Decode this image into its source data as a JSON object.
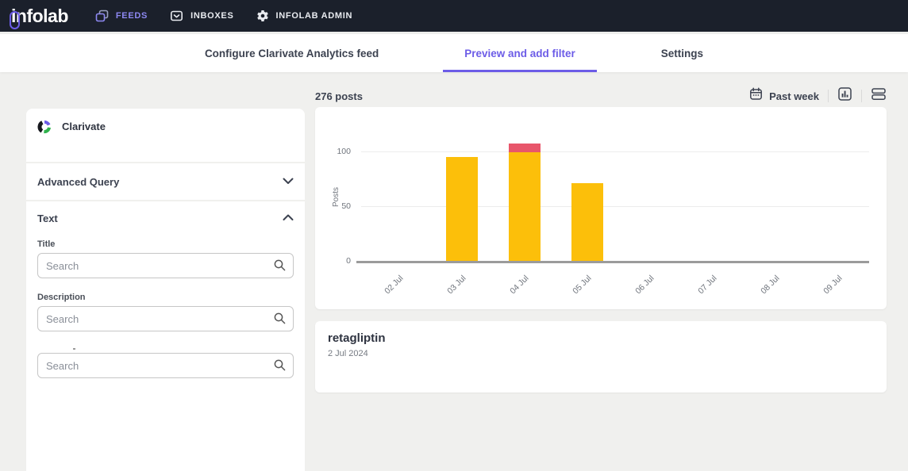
{
  "topbar": {
    "logo": "infolab",
    "nav": [
      {
        "label": "FEEDS",
        "icon": "feeds-icon",
        "active": true
      },
      {
        "label": "INBOXES",
        "icon": "inboxes-icon",
        "active": false
      },
      {
        "label": "INFOLAB ADMIN",
        "icon": "gear-icon",
        "active": false
      }
    ]
  },
  "tabs": [
    {
      "label": "Configure Clarivate Analytics feed",
      "active": false
    },
    {
      "label": "Preview and add filter",
      "active": true
    },
    {
      "label": "Settings",
      "active": false
    }
  ],
  "sidebar": {
    "source": {
      "name": "Clarivate",
      "icon": "clarivate-logo"
    },
    "advanced_query": {
      "label": "Advanced Query",
      "state": "collapsed",
      "icon": "chevron-down-icon"
    },
    "text_section": {
      "label": "Text",
      "state": "expanded",
      "icon": "chevron-up-icon"
    },
    "fields": [
      {
        "label": "Title",
        "placeholder": "Search",
        "value": ""
      },
      {
        "label": "Description",
        "placeholder": "Search",
        "value": ""
      },
      {
        "label": "",
        "placeholder": "Search",
        "value": ""
      }
    ]
  },
  "main": {
    "post_count": "276 posts",
    "range_label": "Past week",
    "range_icon": "calendar-icon",
    "view_toggles": [
      "chart-view-icon",
      "list-view-icon"
    ],
    "post": {
      "title": "retagliptin",
      "date": "2 Jul 2024"
    }
  },
  "colors": {
    "accent_purple": "#6c5ce7",
    "nav_purple": "#8d88f2",
    "bar_yellow": "#fcbf0a",
    "bar_red": "#e8566b",
    "topbar_bg": "#1b202b",
    "page_bg": "#f0f0ee"
  },
  "chart_data": {
    "type": "bar",
    "stacked": true,
    "categories": [
      "02 Jul",
      "03 Jul",
      "04 Jul",
      "05 Jul",
      "06 Jul",
      "07 Jul",
      "08 Jul",
      "09 Jul"
    ],
    "series": [
      {
        "name": "posts-primary",
        "color": "#fcbf0a",
        "values": [
          0,
          96,
          100,
          72,
          0,
          0,
          0,
          0
        ]
      },
      {
        "name": "posts-secondary",
        "color": "#e8566b",
        "values": [
          0,
          0,
          8,
          0,
          0,
          0,
          0,
          0
        ]
      }
    ],
    "title": "",
    "xlabel": "",
    "ylabel": "Posts",
    "yticks": [
      0,
      50,
      100
    ],
    "ylim": [
      0,
      110
    ],
    "grid": "horizontal",
    "legend": "none"
  }
}
